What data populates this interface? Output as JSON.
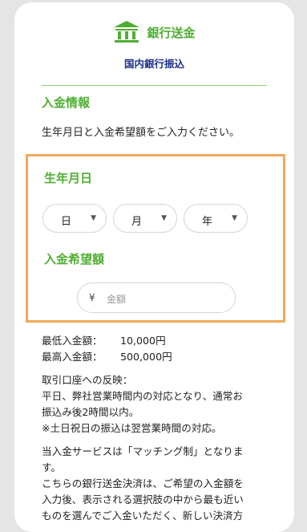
{
  "header": {
    "brand_title": "銀行送金",
    "subtitle": "国内銀行振込"
  },
  "section1": {
    "title": "入金情報",
    "intro": "生年月日と入金希望額をご入力ください。"
  },
  "birthdate": {
    "title": "生年月日",
    "day": "日",
    "month": "月",
    "year": "年"
  },
  "amount": {
    "title": "入金希望額",
    "currency": "¥",
    "placeholder": "金額"
  },
  "info": {
    "min_label": "最低入金額：",
    "min_value": "10,000円",
    "max_label": "最高入金額：",
    "max_value": "500,000円",
    "reflection_title": "取引口座への反映：",
    "reflection_line1": "平日、弊社営業時間内の対応となり、通常お",
    "reflection_line2": "振込み後2時間以内。",
    "reflection_line3": "※土日祝日の振込は翌営業時間の対応。",
    "service_line1": "当入金サービスは「マッチング制」となりま",
    "service_line2": "す。",
    "service_line3": "こちらの銀行送金決済は、ご希望の入金額を",
    "service_line4": "入力後、表示される選択肢の中から最も近い",
    "service_line5": "ものを選んでご入金いただく、新しい決済方"
  },
  "colors": {
    "green": "#4fae32",
    "navy": "#1c2f8a",
    "highlight": "#f2a85a"
  }
}
